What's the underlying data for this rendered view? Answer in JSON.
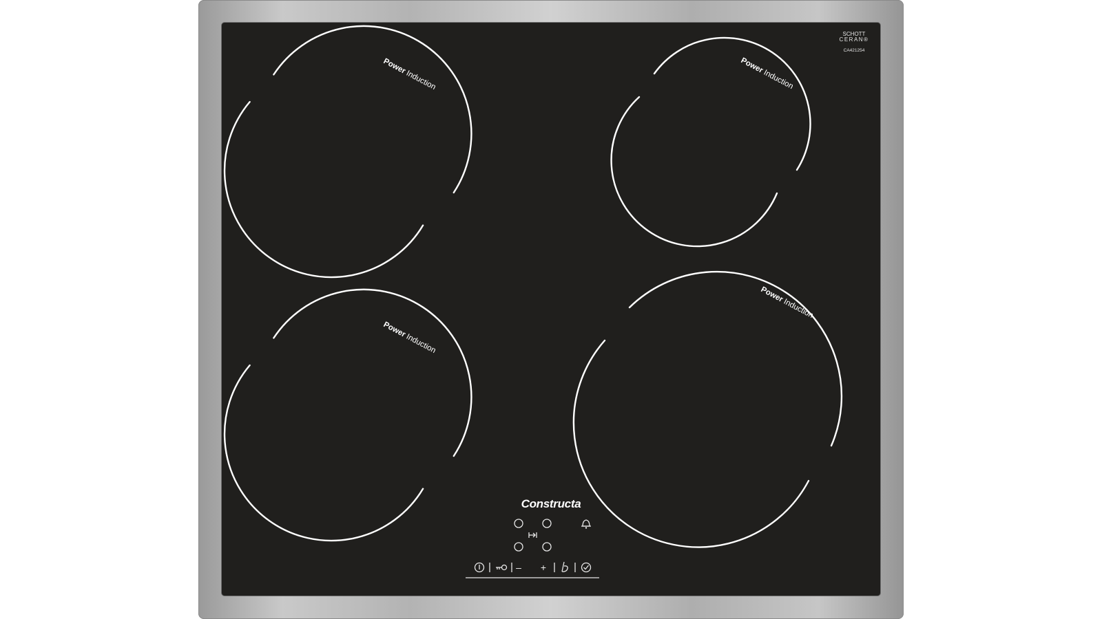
{
  "hob": {
    "brand": "Constructa",
    "glass_brand_line1": "SCHOTT",
    "glass_brand_line2": "CERAN®",
    "model_code": "CA421254",
    "colors": {
      "glass": "#201f1d",
      "frame": "#b8b8b8",
      "markings": "#ffffff"
    },
    "zones": [
      {
        "id": "front-left-top",
        "label_bold": "Power",
        "label_regular": "Induction"
      },
      {
        "id": "top-right",
        "label_bold": "Power",
        "label_regular": "Induction"
      },
      {
        "id": "bottom-left",
        "label_bold": "Power",
        "label_regular": "Induction"
      },
      {
        "id": "bottom-right",
        "label_bold": "Power",
        "label_regular": "Induction"
      }
    ],
    "controls": {
      "minus_label": "–",
      "plus_label": "+",
      "icons": [
        "power-icon",
        "child-lock-icon",
        "minus-icon",
        "plus-icon",
        "booster-icon",
        "timer-icon",
        "bell-icon",
        "zone-select-icon",
        "next-zone-icon"
      ]
    }
  }
}
